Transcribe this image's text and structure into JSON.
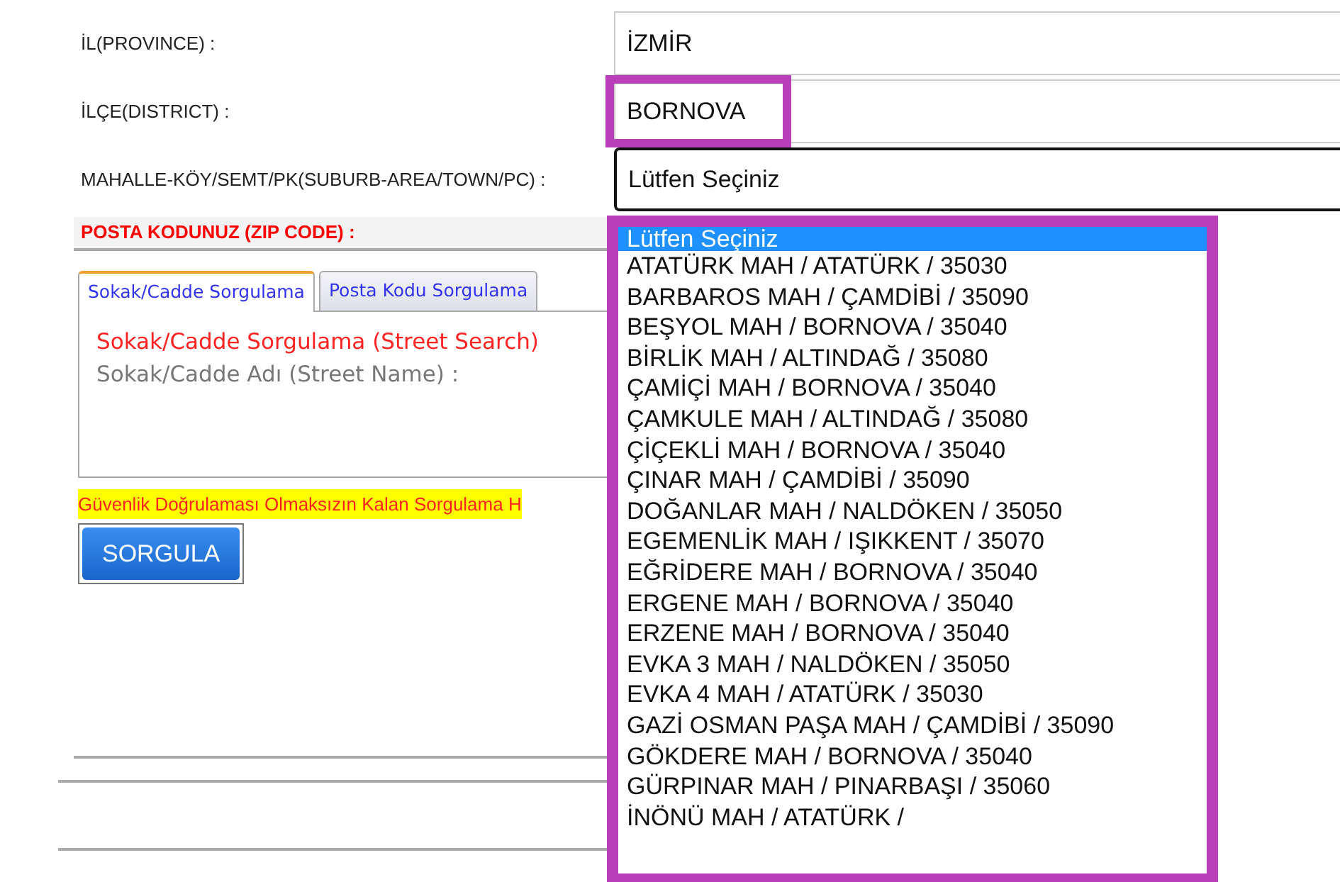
{
  "fields": [
    {
      "label": "İL(PROVINCE) :",
      "value": "İZMİR",
      "highlighted": false,
      "focused": false
    },
    {
      "label": "İLÇE(DISTRICT) :",
      "value": "BORNOVA",
      "highlighted": true,
      "focused": false
    },
    {
      "label": "MAHALLE-KÖY/SEMT/PK(SUBURB-AREA/TOWN/PC) :",
      "value": "Lütfen Seçiniz",
      "highlighted": false,
      "focused": true
    }
  ],
  "zip_label": "POSTA KODUNUZ (ZIP CODE) :",
  "tabs": [
    {
      "label": "Sokak/Cadde Sorgulama",
      "selected": true
    },
    {
      "label": "Posta Kodu Sorgulama",
      "selected": false
    }
  ],
  "tab_panel": {
    "title": "Sokak/Cadde Sorgulama (Street Search)",
    "field_label": "Sokak/Cadde Adı (Street Name) :"
  },
  "notice": "Güvenlik Doğrulaması Olmaksızın Kalan Sorgulama H",
  "submit_button": "SORGULA",
  "dropdown": {
    "highlighted": true,
    "options": [
      {
        "label": "Lütfen Seçiniz",
        "selected": true
      },
      {
        "label": "ATATÜRK MAH / ATATÜRK / 35030",
        "selected": false
      },
      {
        "label": "BARBAROS MAH / ÇAMDİBİ / 35090",
        "selected": false
      },
      {
        "label": "BEŞYOL MAH / BORNOVA / 35040",
        "selected": false
      },
      {
        "label": "BİRLİK MAH / ALTINDAĞ / 35080",
        "selected": false
      },
      {
        "label": "ÇAMİÇİ MAH / BORNOVA / 35040",
        "selected": false
      },
      {
        "label": "ÇAMKULE MAH / ALTINDAĞ / 35080",
        "selected": false
      },
      {
        "label": "ÇİÇEKLİ MAH / BORNOVA / 35040",
        "selected": false
      },
      {
        "label": "ÇINAR MAH / ÇAMDİBİ / 35090",
        "selected": false
      },
      {
        "label": "DOĞANLAR MAH / NALDÖKEN / 35050",
        "selected": false
      },
      {
        "label": "EGEMENLİK MAH / IŞIKKENT / 35070",
        "selected": false
      },
      {
        "label": "EĞRİDERE MAH / BORNOVA / 35040",
        "selected": false
      },
      {
        "label": "ERGENE MAH / BORNOVA / 35040",
        "selected": false
      },
      {
        "label": "ERZENE MAH / BORNOVA / 35040",
        "selected": false
      },
      {
        "label": "EVKA 3 MAH / NALDÖKEN / 35050",
        "selected": false
      },
      {
        "label": "EVKA 4 MAH / ATATÜRK / 35030",
        "selected": false
      },
      {
        "label": "GAZİ OSMAN PAŞA MAH / ÇAMDİBİ / 35090",
        "selected": false
      },
      {
        "label": "GÖKDERE MAH / BORNOVA / 35040",
        "selected": false
      },
      {
        "label": "GÜRPINAR MAH / PINARBAŞI / 35060",
        "selected": false
      },
      {
        "label": "İNÖNÜ MAH / ATATÜRK /",
        "selected": false
      }
    ]
  }
}
